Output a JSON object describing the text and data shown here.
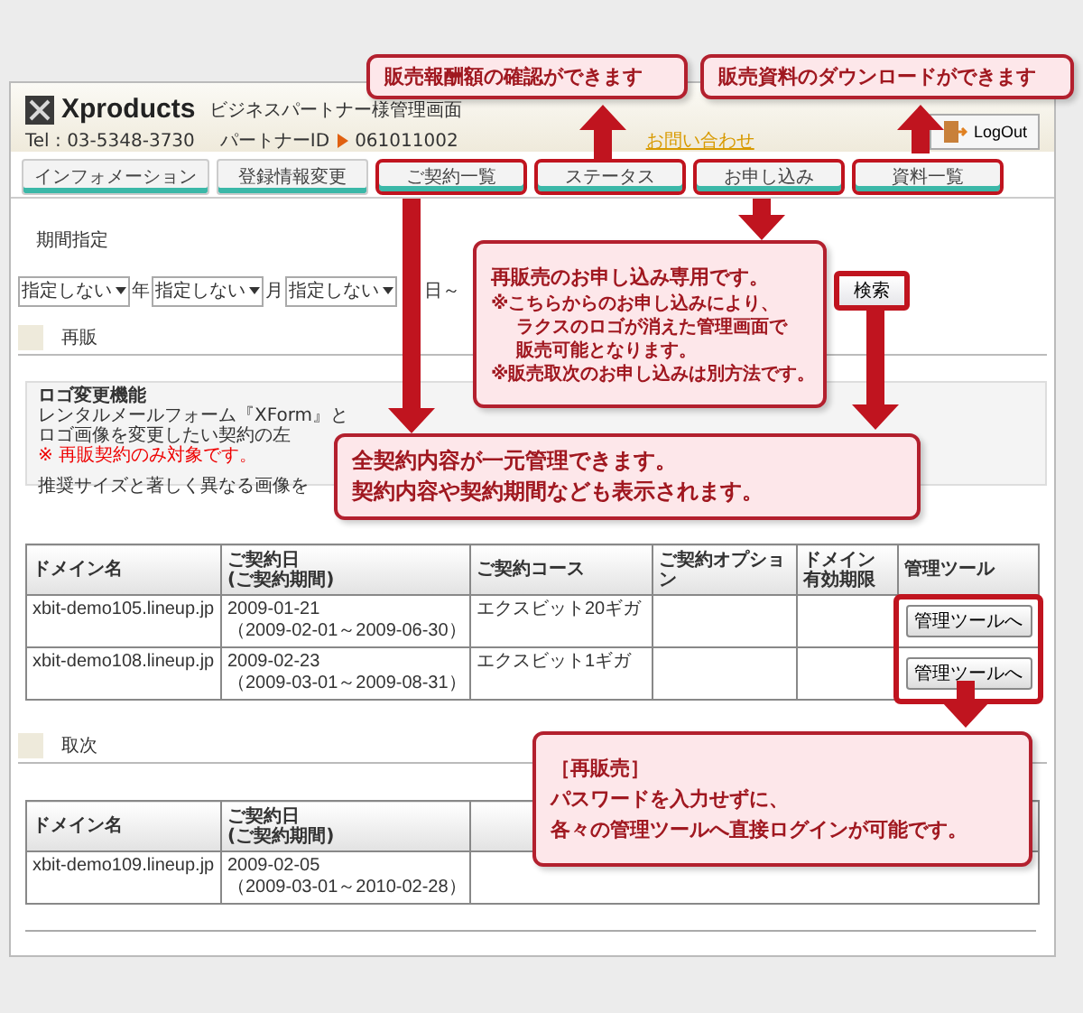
{
  "header": {
    "logo": "Xproducts",
    "subtitle": "ビジネスパートナー様管理画面",
    "tel": "Tel : 03-5348-3730",
    "partner_label": "パートナーID",
    "partner_id": "061011002",
    "contact_link": "お問い合わせ",
    "logout_button": "LogOut"
  },
  "tabs": [
    {
      "label": "インフォメーション",
      "highlighted": false
    },
    {
      "label": "登録情報変更",
      "highlighted": false
    },
    {
      "label": "ご契約一覧",
      "highlighted": true
    },
    {
      "label": "ステータス",
      "highlighted": true
    },
    {
      "label": "お申し込み",
      "highlighted": true
    },
    {
      "label": "資料一覧",
      "highlighted": true
    }
  ],
  "filter": {
    "label": "期間指定",
    "selects": [
      {
        "value": "指定しない",
        "unit": "年"
      },
      {
        "value": "指定しない",
        "unit": "月"
      },
      {
        "value": "指定しない",
        "unit": "日～"
      }
    ],
    "search_button": "検索",
    "search_highlighted": true
  },
  "resale": {
    "heading": "再販",
    "notice": {
      "title": "ロゴ変更機能",
      "lines": [
        {
          "kind": "normal",
          "text": "レンタルメールフォーム『XForm』と"
        },
        {
          "kind": "normal",
          "text": "ロゴ画像を変更したい契約の左"
        },
        {
          "kind": "warning",
          "text": "※ 再販契約のみ対象です。"
        },
        {
          "kind": "normal",
          "text": "推奨サイズと著しく異なる画像を"
        }
      ]
    },
    "columns": [
      "ドメイン名",
      "ご契約日\n(ご契約期間)",
      "ご契約コース",
      "ご契約オプション",
      "ドメイン有効期限",
      "管理ツール"
    ],
    "rows": [
      {
        "domain": "xbit-demo105.lineup.jp",
        "date": "2009-01-21",
        "period": "（2009-02-01～2009-06-30）",
        "course": "エクスビット20ギガ",
        "tool_button": "管理ツールへ"
      },
      {
        "domain": "xbit-demo108.lineup.jp",
        "date": "2009-02-23",
        "period": "（2009-03-01～2009-08-31）",
        "course": "エクスビット1ギガ",
        "tool_button": "管理ツールへ"
      }
    ],
    "tools_highlighted": true
  },
  "agency": {
    "heading": "取次",
    "columns": [
      "ドメイン名",
      "ご契約日\n(ご契約期間)"
    ],
    "rows": [
      {
        "domain": "xbit-demo109.lineup.jp",
        "date": "2009-02-05",
        "period": "（2009-03-01～2010-02-28）"
      }
    ]
  },
  "callouts": [
    {
      "title_lines": [
        "販売報酬額の確認ができます"
      ]
    },
    {
      "title_lines": [
        "販売資料のダウンロードができます"
      ]
    },
    {
      "title_lines": [
        "再販売のお申し込み専用です。"
      ],
      "notes": [
        {
          "text": "※こちらからのお申し込みにより、",
          "indent": false
        },
        {
          "text": "ラクスのロゴが消えた管理画面で",
          "indent": true
        },
        {
          "text": "販売可能となります。",
          "indent": true
        },
        {
          "text": "※販売取次のお申し込みは別方法です。",
          "indent": false
        }
      ]
    },
    {
      "title_lines": [
        "全契約内容が一元管理できます。",
        "契約内容や契約期間なども表示されます。"
      ]
    },
    {
      "title_lines": [
        "［再販売］",
        "パスワードを入力せずに、",
        "各々の管理ツールへ直接ログインが可能です。"
      ]
    }
  ]
}
